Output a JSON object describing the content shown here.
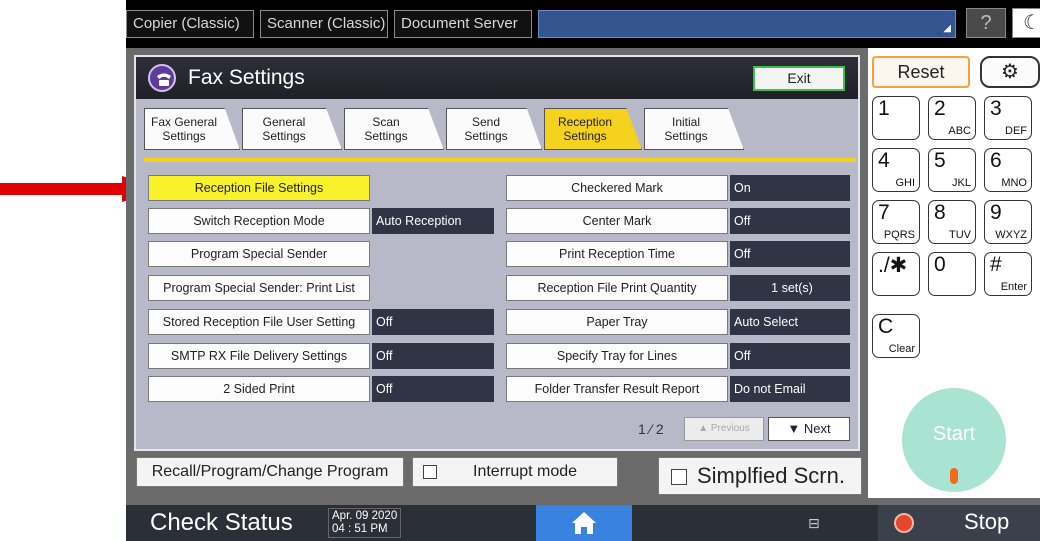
{
  "topbar": {
    "tabs": [
      "Copier (Classic)",
      "Scanner (Classic)",
      "Document Server"
    ],
    "help_label": "?",
    "moon_label": "☾"
  },
  "panel": {
    "title": "Fax Settings",
    "exit_label": "Exit",
    "tabs": [
      {
        "line1": "Fax General",
        "line2": "Settings"
      },
      {
        "line1": "General",
        "line2": "Settings"
      },
      {
        "line1": "Scan",
        "line2": "Settings"
      },
      {
        "line1": "Send",
        "line2": "Settings"
      },
      {
        "line1": "Reception",
        "line2": "Settings"
      },
      {
        "line1": "Initial",
        "line2": "Settings"
      }
    ],
    "active_tab": "Reception Settings",
    "left_items": [
      {
        "label": "Reception File Settings",
        "value": ""
      },
      {
        "label": "Switch Reception Mode",
        "value": "Auto Reception"
      },
      {
        "label": "Program Special Sender",
        "value": ""
      },
      {
        "label": "Program Special Sender: Print List",
        "value": ""
      },
      {
        "label": "Stored Reception File User Setting",
        "value": "Off"
      },
      {
        "label": "SMTP RX File Delivery Settings",
        "value": "Off"
      },
      {
        "label": "2 Sided Print",
        "value": "Off"
      }
    ],
    "right_items": [
      {
        "label": "Checkered Mark",
        "value": "On"
      },
      {
        "label": "Center Mark",
        "value": "Off"
      },
      {
        "label": "Print Reception Time",
        "value": "Off"
      },
      {
        "label": "Reception File Print Quantity",
        "value": "1  set(s)"
      },
      {
        "label": "Paper Tray",
        "value": "Auto Select"
      },
      {
        "label": "Specify Tray for Lines",
        "value": "Off"
      },
      {
        "label": "Folder Transfer Result Report",
        "value": "Do not Email"
      }
    ],
    "pager": "1 ⁄ 2",
    "previous_label": "▲ Previous",
    "next_label": "▼  Next"
  },
  "bottom": {
    "recall_label": "Recall/Program/Change Program",
    "interrupt_label": "Interrupt mode",
    "simplified_label": "Simplfied Scrn."
  },
  "keypad": {
    "reset_label": "Reset",
    "gear_label": "⚙",
    "keys": [
      {
        "main": "1",
        "sub": ""
      },
      {
        "main": "2",
        "sub": "ABC"
      },
      {
        "main": "3",
        "sub": "DEF"
      },
      {
        "main": "4",
        "sub": "GHI"
      },
      {
        "main": "5",
        "sub": "JKL"
      },
      {
        "main": "6",
        "sub": "MNO"
      },
      {
        "main": "7",
        "sub": "PQRS"
      },
      {
        "main": "8",
        "sub": "TUV"
      },
      {
        "main": "9",
        "sub": "WXYZ"
      },
      {
        "main": "./✱",
        "sub": ""
      },
      {
        "main": "0",
        "sub": ""
      },
      {
        "main": "#",
        "sub": "Enter"
      },
      {
        "main": "C",
        "sub": "Clear"
      }
    ],
    "start_label": "Start"
  },
  "statusbar": {
    "check_status": "Check Status",
    "date": "Apr. 09 2020",
    "time": "04 : 51 PM",
    "stop_label": "Stop"
  },
  "colors": {
    "highlight": "#f7f22a",
    "active_tab": "#f5d21d",
    "value_bg": "#2f3545",
    "reset_border": "#f0a33a",
    "start_bg": "#a9e3d1",
    "home_bg": "#3a82df",
    "arrow": "#e00000"
  }
}
